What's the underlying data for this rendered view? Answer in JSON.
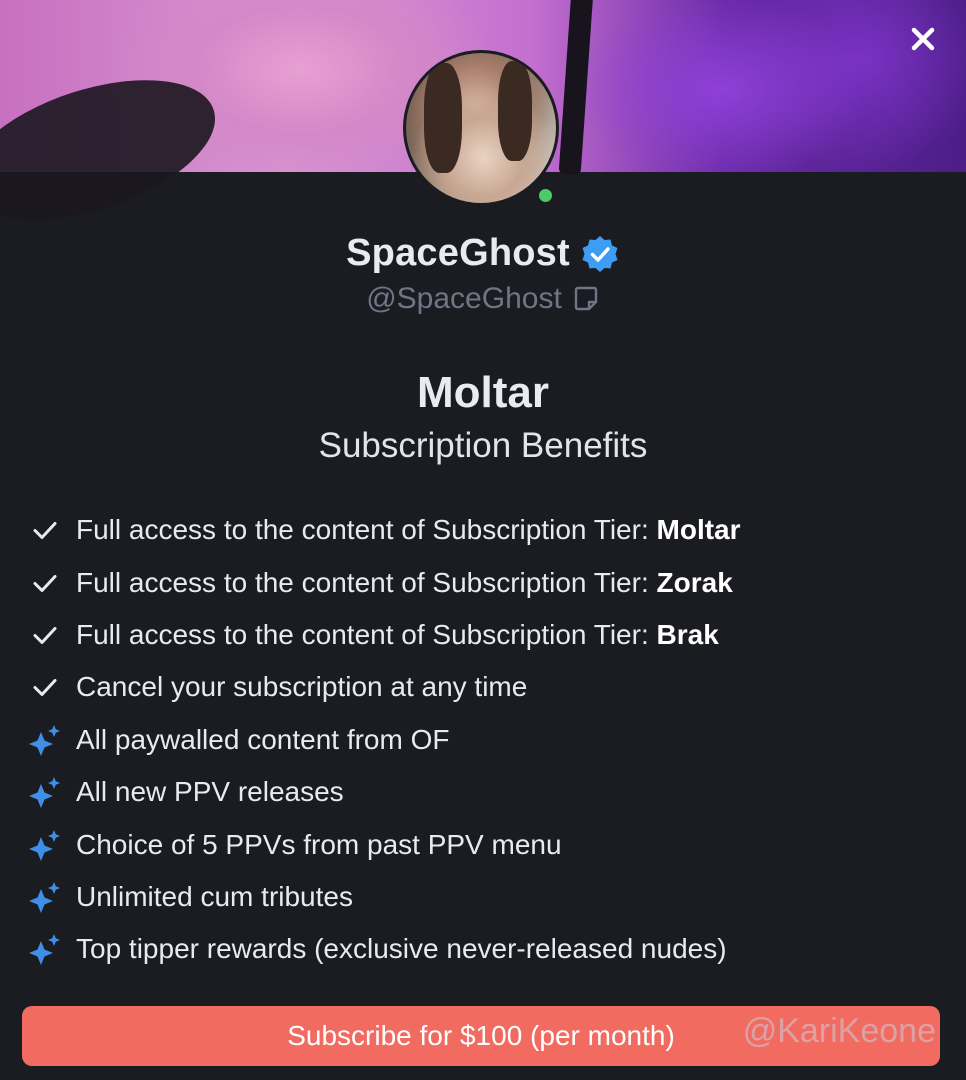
{
  "profile": {
    "display_name": "SpaceGhost",
    "handle": "@SpaceGhost",
    "verified": true,
    "online": true
  },
  "tier": {
    "name": "Moltar",
    "subtitle": "Subscription Benefits"
  },
  "benefits": [
    {
      "icon": "check-icon",
      "text": "Full access to the content of Subscription Tier: ",
      "bold": "Moltar"
    },
    {
      "icon": "check-icon",
      "text": "Full access to the content of Subscription Tier: ",
      "bold": "Zorak"
    },
    {
      "icon": "check-icon",
      "text": "Full access to the content of Subscription Tier: ",
      "bold": "Brak"
    },
    {
      "icon": "check-icon",
      "text": "Cancel your subscription at any time",
      "bold": ""
    },
    {
      "icon": "sparkle-icon",
      "text": "All paywalled content from OF",
      "bold": ""
    },
    {
      "icon": "sparkle-icon",
      "text": "All new PPV releases",
      "bold": ""
    },
    {
      "icon": "sparkle-icon",
      "text": "Choice of 5 PPVs from past PPV menu",
      "bold": ""
    },
    {
      "icon": "sparkle-icon",
      "text": "Unlimited cum tributes",
      "bold": ""
    },
    {
      "icon": "sparkle-icon",
      "text": "Top tipper rewards (exclusive never-released nudes)",
      "bold": ""
    }
  ],
  "subscribe": {
    "label": "Subscribe for $100 (per month)"
  },
  "watermark": "@KariKeone",
  "colors": {
    "background": "#1b1c21",
    "accent": "#f26b60",
    "verified": "#3d9df5",
    "online": "#4cc96a",
    "sparkle": "#3f8ee8"
  }
}
